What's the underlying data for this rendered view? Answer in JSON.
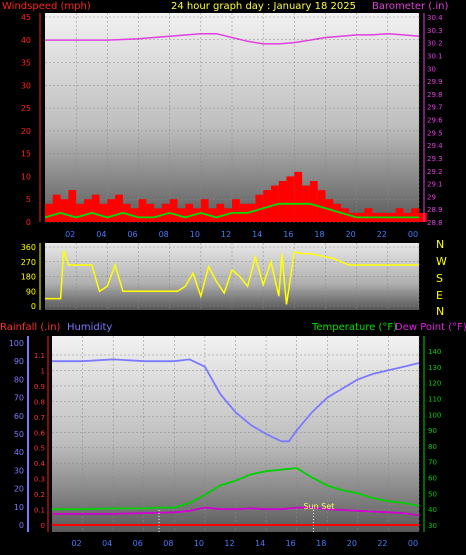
{
  "header": {
    "left_label": "Windspeed (mph)",
    "title": "24 hour graph day : January 18 2025",
    "right_label": "Barometer (.in)"
  },
  "bottom_header": {
    "rain_label": "Rainfall (.in)",
    "humidity_label": "Humidity",
    "temp_label": "Temperature (°F)",
    "dew_label": "Dew Point (°F)"
  },
  "compass": [
    "N",
    "W",
    "S",
    "E",
    "N"
  ],
  "sunset_label": "Sun Set",
  "colors": {
    "wind": "#ff0000",
    "gust": "#ff0000",
    "avg_wind": "#00e000",
    "avg_wind2": "#ffffff",
    "baro": "#e040e0",
    "dir": "#ffff00",
    "humidity": "#7a7aff",
    "temp": "#00d000",
    "dew": "#d000d0",
    "rain": "#ff0000"
  },
  "chart_data": [
    {
      "type": "line",
      "name": "wind-barometer",
      "x_ticks": [
        "02",
        "04",
        "06",
        "08",
        "10",
        "12",
        "14",
        "16",
        "18",
        "20",
        "22",
        "00"
      ],
      "yleft_ticks": [
        "0",
        "5",
        "10",
        "15",
        "20",
        "25",
        "30",
        "35",
        "40",
        "45"
      ],
      "yleft_lim": [
        0,
        45
      ],
      "yright_ticks": [
        "28.8",
        "28.9",
        "29",
        "29.1",
        "29.2",
        "29.3",
        "29.4",
        "29.5",
        "29.6",
        "29.7",
        "29.8",
        "29.9",
        "30",
        "30.1",
        "30.2",
        "30.3",
        "30.4"
      ],
      "yright_lim": [
        28.8,
        30.4
      ],
      "xlim": [
        0,
        24
      ],
      "series": [
        {
          "name": "Barometer",
          "axis": "right",
          "color": "baro",
          "x": [
            0,
            2,
            4,
            6,
            8,
            10,
            11,
            12,
            13,
            14,
            15,
            16,
            17,
            18,
            19,
            20,
            21,
            22,
            23,
            24
          ],
          "values": [
            30.22,
            30.22,
            30.22,
            30.23,
            30.25,
            30.27,
            30.27,
            30.24,
            30.21,
            30.19,
            30.19,
            30.2,
            30.22,
            30.24,
            30.25,
            30.26,
            30.26,
            30.27,
            30.26,
            30.25
          ]
        },
        {
          "name": "Wind gust",
          "axis": "left",
          "color": "gust",
          "style": "bars",
          "x": [
            0,
            0.5,
            1,
            1.5,
            2,
            2.5,
            3,
            3.5,
            4,
            4.5,
            5,
            5.5,
            6,
            6.5,
            7,
            7.5,
            8,
            8.5,
            9,
            9.5,
            10,
            10.5,
            11,
            11.5,
            12,
            12.5,
            13,
            13.5,
            14,
            14.5,
            15,
            15.5,
            16,
            16.5,
            17,
            17.5,
            18,
            18.5,
            19,
            19.5,
            20,
            20.5,
            21,
            21.5,
            22,
            22.5,
            23,
            23.5,
            24
          ],
          "values": [
            4,
            6,
            5,
            7,
            4,
            5,
            6,
            4,
            5,
            6,
            4,
            3,
            5,
            4,
            3,
            4,
            5,
            3,
            4,
            3,
            5,
            3,
            4,
            3,
            5,
            4,
            4,
            6,
            7,
            8,
            9,
            10,
            11,
            8,
            9,
            7,
            5,
            4,
            3,
            2,
            2,
            3,
            2,
            2,
            2,
            3,
            2,
            3,
            2
          ]
        },
        {
          "name": "Average wind",
          "axis": "left",
          "color": "avg_wind",
          "x": [
            0,
            1,
            2,
            3,
            4,
            5,
            6,
            7,
            8,
            9,
            10,
            11,
            12,
            13,
            14,
            15,
            16,
            17,
            18,
            19,
            20,
            21,
            22,
            23,
            24
          ],
          "values": [
            1,
            2,
            1,
            2,
            1,
            2,
            1,
            1,
            2,
            1,
            2,
            1,
            2,
            2,
            3,
            4,
            4,
            4,
            3,
            2,
            1,
            1,
            1,
            1,
            1
          ]
        }
      ]
    },
    {
      "type": "scatter",
      "name": "wind-direction",
      "yleft_ticks": [
        "0",
        "90",
        "180",
        "270",
        "360"
      ],
      "ylim": [
        0,
        360
      ],
      "xlim": [
        0,
        24
      ],
      "series": [
        {
          "name": "Direction",
          "color": "dir",
          "x": [
            0,
            1,
            1.2,
            1.5,
            2.5,
            3,
            3.5,
            4,
            4.5,
            5,
            7,
            8.5,
            9,
            9.5,
            10,
            10.5,
            11,
            11.5,
            12,
            12.5,
            13,
            13.5,
            14,
            14.5,
            15,
            15.2,
            15.5,
            16,
            16.5,
            17,
            17.5,
            18,
            18.5,
            19,
            19.5,
            20,
            21,
            22,
            23,
            24
          ],
          "values": [
            45,
            45,
            340,
            250,
            250,
            250,
            90,
            120,
            250,
            90,
            90,
            90,
            120,
            200,
            60,
            240,
            150,
            80,
            220,
            180,
            120,
            300,
            130,
            270,
            60,
            320,
            10,
            330,
            320,
            320,
            310,
            300,
            290,
            270,
            250,
            250,
            250,
            250,
            250,
            250
          ]
        }
      ]
    },
    {
      "type": "line",
      "name": "humidity-temperature",
      "x_ticks": [
        "02",
        "04",
        "06",
        "08",
        "10",
        "12",
        "14",
        "16",
        "18",
        "20",
        "22",
        "00"
      ],
      "yleft_outer_ticks": [
        "0",
        "10",
        "20",
        "30",
        "40",
        "50",
        "60",
        "70",
        "80",
        "90",
        "100"
      ],
      "yleft_inner_ticks": [
        "0",
        "0.1",
        "0.2",
        "0.3",
        "0.4",
        "0.5",
        "0.6",
        "0.7",
        "0.8",
        "0.9",
        "1",
        "1.1"
      ],
      "yright_ticks": [
        "30",
        "40",
        "50",
        "60",
        "70",
        "80",
        "90",
        "100",
        "110",
        "120",
        "130",
        "140"
      ],
      "xlim": [
        0,
        24
      ],
      "series": [
        {
          "name": "Humidity",
          "axis": "outer",
          "color": "humidity",
          "x": [
            0,
            2,
            4,
            6,
            8,
            9,
            10,
            11,
            12,
            13,
            14,
            15,
            15.5,
            16,
            17,
            18,
            19,
            20,
            21,
            22,
            23,
            24
          ],
          "values": [
            90,
            90,
            91,
            90,
            90,
            91,
            87,
            72,
            62,
            55,
            50,
            46,
            46,
            52,
            62,
            70,
            75,
            80,
            83,
            85,
            87,
            89
          ]
        },
        {
          "name": "Temperature",
          "axis": "right",
          "color": "temp",
          "x": [
            0,
            2,
            4,
            6,
            7,
            8,
            9,
            10,
            11,
            12,
            13,
            14,
            15,
            16,
            17,
            18,
            19,
            20,
            21,
            22,
            23,
            24
          ],
          "values": [
            40,
            40,
            40.5,
            40.5,
            41,
            41,
            44,
            49,
            55,
            58,
            62,
            64,
            65,
            66,
            60,
            55,
            52,
            50,
            47,
            45,
            44,
            42
          ]
        },
        {
          "name": "Dew Point",
          "axis": "right",
          "color": "dew",
          "x": [
            0,
            2,
            4,
            6,
            8,
            9,
            10,
            11,
            12,
            13,
            14,
            15,
            16,
            17,
            18,
            19,
            20,
            21,
            22,
            23,
            24
          ],
          "values": [
            37,
            37,
            37,
            37.5,
            38,
            39,
            41,
            40,
            40,
            40.5,
            40,
            40,
            41,
            41,
            40,
            39.5,
            39,
            38.5,
            38,
            37.5,
            36
          ]
        },
        {
          "name": "Rainfall",
          "axis": "inner",
          "color": "rain",
          "x": [
            0,
            24
          ],
          "values": [
            0,
            0
          ]
        }
      ],
      "markers": [
        {
          "x": 7,
          "label": ""
        },
        {
          "x": 17.1,
          "label": "Sun Set"
        }
      ]
    }
  ]
}
